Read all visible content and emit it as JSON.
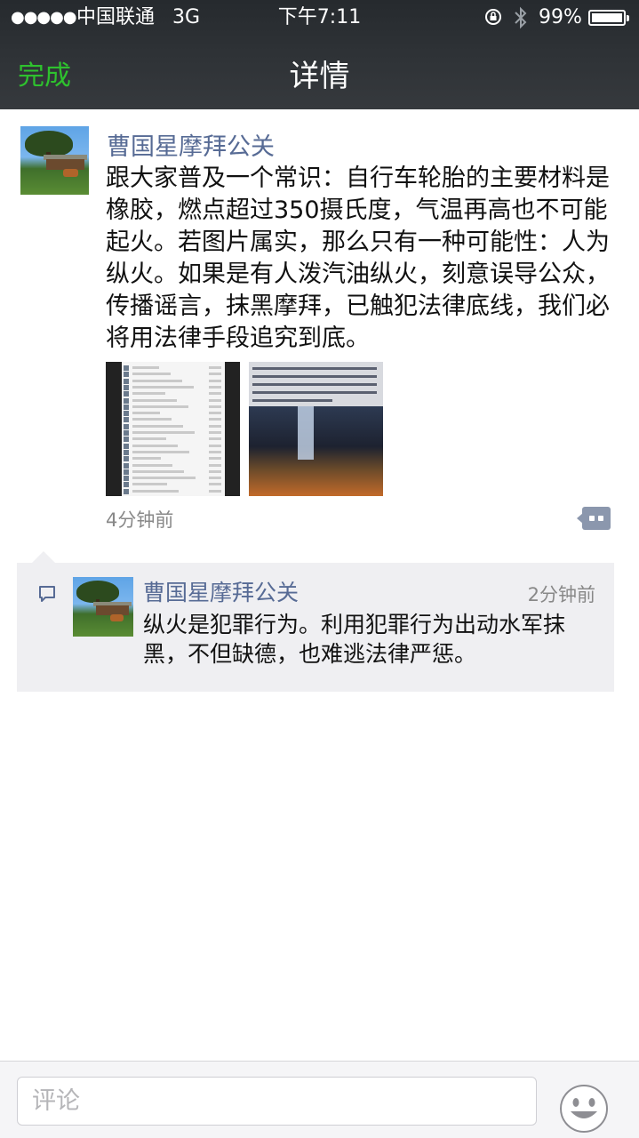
{
  "status_bar": {
    "signal": "●●●●●",
    "carrier": "中国联通",
    "network": "3G",
    "time": "下午7:11",
    "battery": "99%",
    "battery_level": 0.99
  },
  "nav": {
    "done_label": "完成",
    "title": "详情"
  },
  "post": {
    "author": "曹国星摩拜公关",
    "text": "跟大家普及一个常识：自行车轮胎的主要材料是橡胶，燃点超过350摄氏度，气温再高也不可能起火。若图片属实，那么只有一种可能性：人为纵火。如果是有人泼汽油纵火，刻意误导公众，传播谣言，抹黑摩拜，已触犯法律底线，我们必将用法律手段追究到底。",
    "time": "4分钟前",
    "images": [
      "chat-screenshot",
      "burning-bikes-photo"
    ],
    "action_icon": "comment-like-menu-icon"
  },
  "comments": [
    {
      "author": "曹国星摩拜公关",
      "time": "2分钟前",
      "text": "纵火是犯罪行为。利用犯罪行为出动水军抹黑，不但缺德，也难逃法律严惩。"
    }
  ],
  "comment_bar": {
    "placeholder": "评论",
    "emoji_icon": "smiley-icon"
  },
  "colors": {
    "accent_green": "#2ec12e",
    "name_blue": "#576b95",
    "comment_bg": "#efeff2"
  }
}
